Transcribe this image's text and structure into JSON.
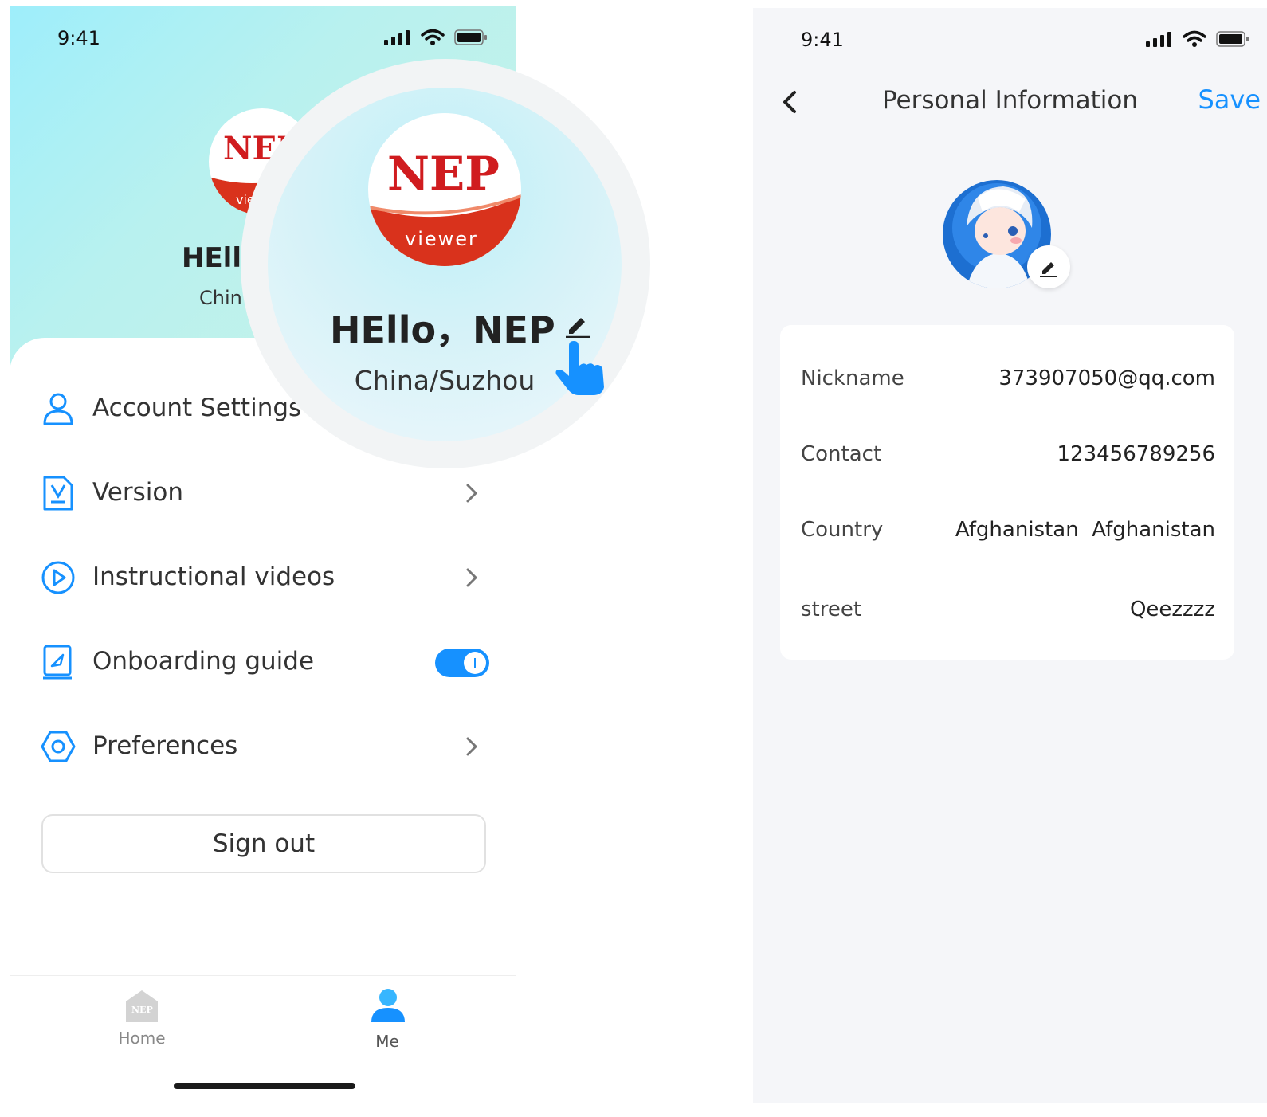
{
  "left": {
    "status_time": "9:41",
    "greeting": "HEllo，NEP",
    "greeting_small": "HEll",
    "location": "China/Suzhou",
    "location_small": "Chin",
    "logo_text": "NEP",
    "logo_subtext": "viewer",
    "menu": [
      {
        "label": "Account Settings",
        "icon": "user-icon"
      },
      {
        "label": "Version",
        "icon": "version-icon"
      },
      {
        "label": "Instructional videos",
        "icon": "play-icon"
      },
      {
        "label": "Onboarding guide",
        "icon": "guide-icon",
        "toggle_on": true
      },
      {
        "label": "Preferences",
        "icon": "preferences-icon"
      }
    ],
    "signout_label": "Sign out",
    "tabs": [
      {
        "label": "Home",
        "icon": "home-icon",
        "color": "#888888"
      },
      {
        "label": "Me",
        "icon": "me-icon",
        "color": "#555555"
      }
    ],
    "home_badge": "NEP"
  },
  "right": {
    "status_time": "9:41",
    "title": "Personal Information",
    "save_label": "Save",
    "fields": [
      {
        "label": "Nickname",
        "value": "373907050@qq.com"
      },
      {
        "label": "Contact",
        "value": "123456789256"
      },
      {
        "label": "Country",
        "value": "Afghanistan  Afghanistan"
      },
      {
        "label": "street",
        "value": "Qeezzzz"
      }
    ]
  },
  "colors": {
    "accent": "#1691ff",
    "logo_red": "#d01c1f",
    "header_gradient_start": "#9eeefb",
    "header_gradient_end": "#c9f2e6"
  }
}
